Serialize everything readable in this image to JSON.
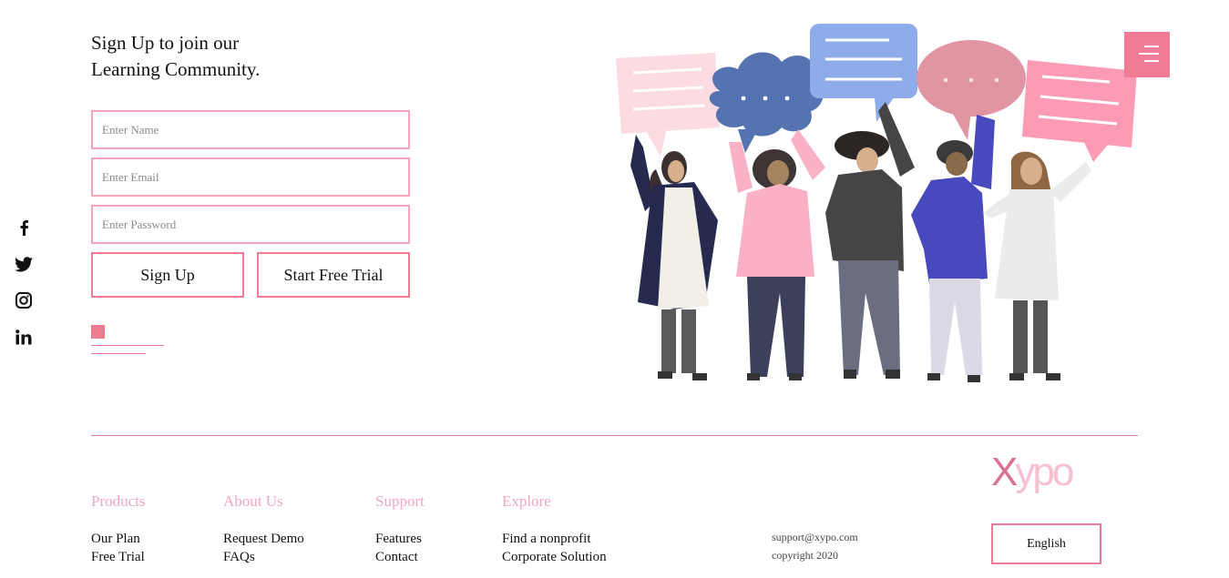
{
  "signup": {
    "heading_line1": "Sign Up to join our",
    "heading_line2": "Learning Community.",
    "name_placeholder": "Enter Name",
    "email_placeholder": "Enter Email",
    "password_placeholder": "Enter Password",
    "signup_label": "Sign Up",
    "trial_label": "Start Free Trial"
  },
  "social": [
    "facebook-icon",
    "twitter-icon",
    "instagram-icon",
    "linkedin-icon"
  ],
  "footer": {
    "columns": [
      {
        "title": "Products",
        "items": [
          "Our Plan",
          "Free Trial"
        ]
      },
      {
        "title": "About Us",
        "items": [
          "Request Demo",
          "FAQs"
        ]
      },
      {
        "title": "Support",
        "items": [
          "Features",
          "Contact"
        ]
      },
      {
        "title": "Explore",
        "items": [
          "Find a nonprofit",
          "Corporate Solution"
        ]
      }
    ],
    "email": "support@xypo.com",
    "copyright": "copyright 2020",
    "logo_x": "X",
    "logo_rest": "ypo",
    "language": "English"
  },
  "colors": {
    "accent": "#ef7b92",
    "pink_light": "#f3a8bd"
  }
}
